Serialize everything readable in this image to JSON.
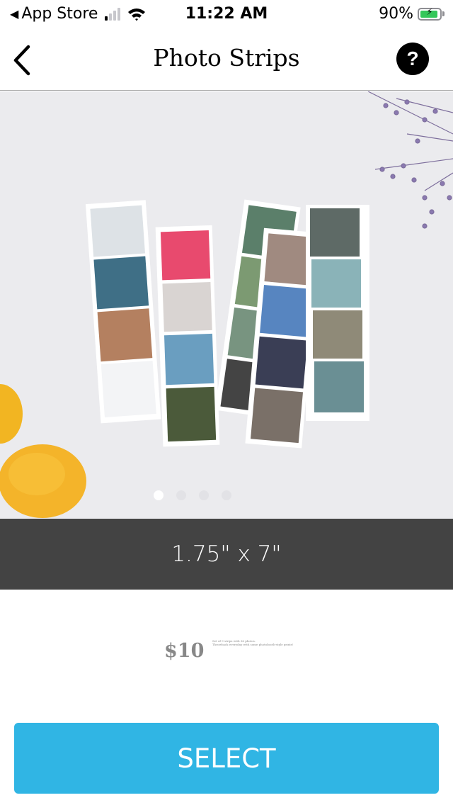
{
  "status_bar": {
    "back_app": "App Store",
    "time": "11:22 AM",
    "battery_percent": "90%",
    "battery_level": 0.9,
    "signal_bars_active": 1,
    "signal_bars_total": 4,
    "charging": true
  },
  "nav": {
    "title": "Photo Strips",
    "back_icon": "chevron-left-icon",
    "help_label": "?"
  },
  "carousel": {
    "image_description": "Four photo strips of printed photos laid on a white surface with lemons and purple flowers",
    "page_count": 4,
    "active_index": 0
  },
  "product": {
    "size": "1.75\" x 7\"",
    "price": "$10",
    "description_lines": [
      "Set of 9 strips with 36 photos.",
      "Throwback everyday with some photobooth-style prints!"
    ]
  },
  "actions": {
    "select_label": "SELECT"
  },
  "colors": {
    "select_button": "#30b5e4",
    "size_bar": "#434343",
    "price_text": "#888888"
  }
}
